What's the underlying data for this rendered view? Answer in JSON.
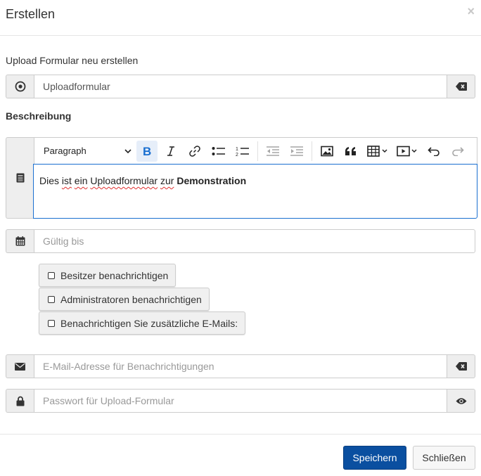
{
  "dialog": {
    "title": "Erstellen",
    "close_symbol": "×"
  },
  "form": {
    "name_label": "Upload Formular neu erstellen",
    "name_value": "Uploadformular",
    "description_label": "Beschreibung",
    "editor": {
      "paragraph_style": "Paragraph",
      "content_parts": [
        {
          "text": "Dies ",
          "bold": false,
          "misspelled": false
        },
        {
          "text": "ist",
          "bold": false,
          "misspelled": true
        },
        {
          "text": " ",
          "bold": false,
          "misspelled": false
        },
        {
          "text": "ein",
          "bold": false,
          "misspelled": true
        },
        {
          "text": " ",
          "bold": false,
          "misspelled": false
        },
        {
          "text": "Uploadformular",
          "bold": false,
          "misspelled": true
        },
        {
          "text": " ",
          "bold": false,
          "misspelled": false
        },
        {
          "text": "zur",
          "bold": false,
          "misspelled": true
        },
        {
          "text": " ",
          "bold": false,
          "misspelled": false
        },
        {
          "text": "Demonstration",
          "bold": true,
          "misspelled": false
        }
      ],
      "toolbar_icons": [
        "bold-icon",
        "italic-icon",
        "link-icon",
        "bulleted-list-icon",
        "numbered-list-icon",
        "outdent-icon",
        "indent-icon",
        "image-icon",
        "blockquote-icon",
        "table-icon",
        "media-icon",
        "undo-icon",
        "redo-icon"
      ]
    },
    "valid_until_placeholder": "Gültig bis",
    "checkboxes": [
      {
        "label": "Besitzer benachrichtigen",
        "checked": false
      },
      {
        "label": "Administratoren benachrichtigen",
        "checked": false
      },
      {
        "label": "Benachrichtigen Sie zusätzliche E-Mails:",
        "checked": false
      }
    ],
    "email_placeholder": "E-Mail-Adresse für Benachrichtigungen",
    "password_placeholder": "Passwort für Upload-Formular"
  },
  "footer": {
    "save_label": "Speichern",
    "close_label": "Schließen"
  },
  "colors": {
    "primary": "#0a4fa0",
    "active_bold": "#1a6fd0",
    "editor_focus_border": "#1a6fd0"
  }
}
